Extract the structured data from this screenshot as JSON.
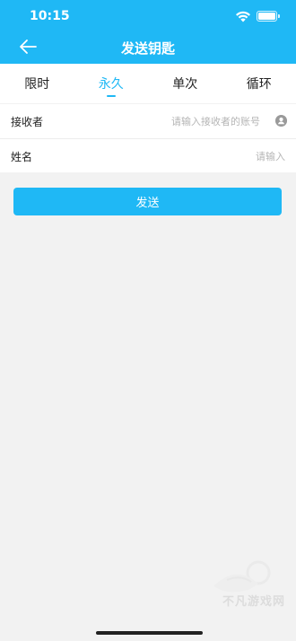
{
  "status_bar": {
    "time": "10:15"
  },
  "nav": {
    "title": "发送钥匙"
  },
  "tabs": [
    {
      "label": "限时",
      "active": false
    },
    {
      "label": "永久",
      "active": true
    },
    {
      "label": "单次",
      "active": false
    },
    {
      "label": "循环",
      "active": false
    }
  ],
  "form": {
    "receiver": {
      "label": "接收者",
      "value": "",
      "placeholder": "请输入接收者的账号"
    },
    "name": {
      "label": "姓名",
      "value": "",
      "placeholder": "请输入"
    }
  },
  "send_button": {
    "label": "发送"
  },
  "watermark": {
    "text": "不凡游戏网"
  },
  "colors": {
    "accent": "#1fb8f5",
    "background": "#f2f2f2"
  }
}
